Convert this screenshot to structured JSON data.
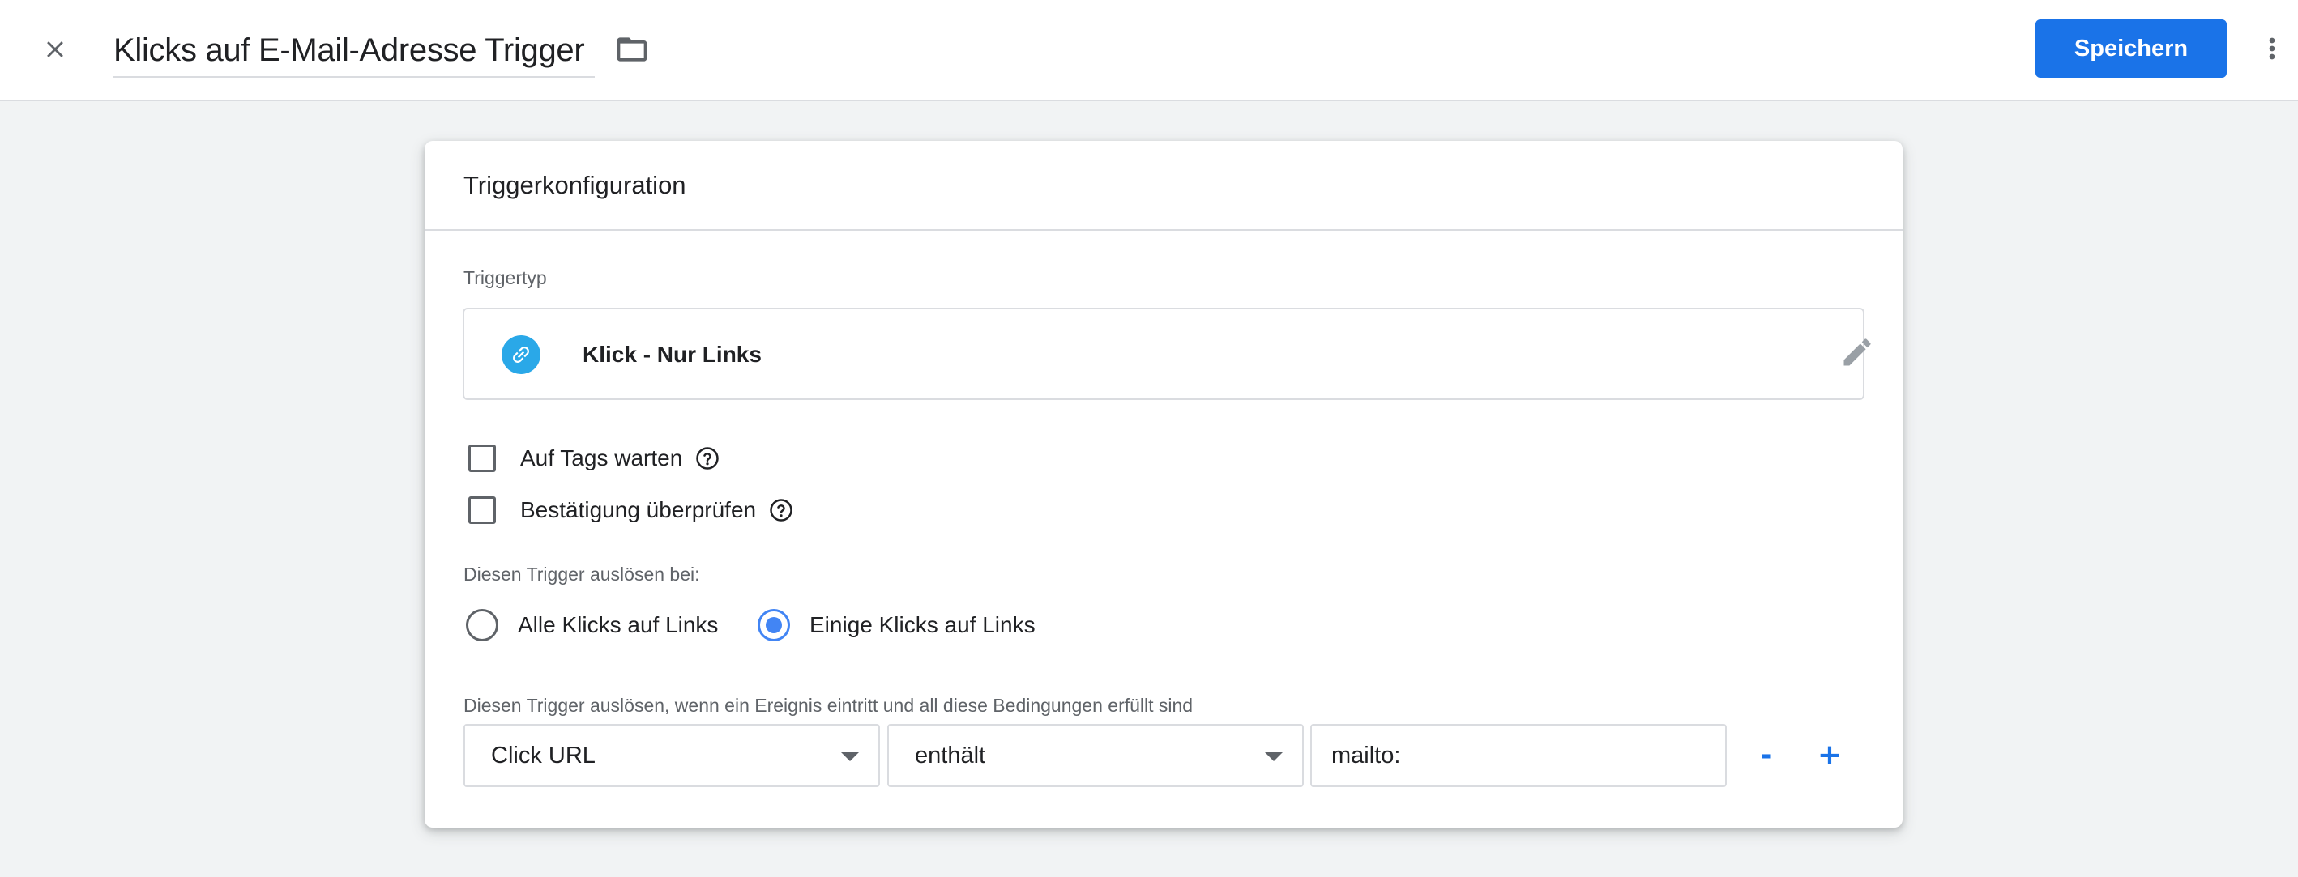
{
  "header": {
    "close_icon": "close-icon",
    "title": "Klicks auf E-Mail-Adresse Trigger",
    "folder_icon": "folder-icon",
    "save_label": "Speichern",
    "more_icon": "more-vert-icon",
    "save_color": "#1a73e8"
  },
  "card": {
    "title": "Triggerkonfiguration",
    "trigger_type_label": "Triggertyp",
    "trigger_type": {
      "icon": "link-icon",
      "icon_color": "#2aa8e8",
      "name": "Klick - Nur Links",
      "edit_icon": "pencil-icon"
    },
    "checkboxes": [
      {
        "label": "Auf Tags warten",
        "checked": false,
        "help_icon": "help-icon"
      },
      {
        "label": "Bestätigung überprüfen",
        "checked": false,
        "help_icon": "help-icon"
      }
    ],
    "fire_on_label": "Diesen Trigger auslösen bei:",
    "radios": [
      {
        "label": "Alle Klicks auf Links",
        "checked": false
      },
      {
        "label": "Einige Klicks auf Links",
        "checked": true
      }
    ],
    "conditions_label": "Diesen Trigger auslösen, wenn ein Ereignis eintritt und all diese Bedingungen erfüllt sind",
    "condition": {
      "variable": "Click URL",
      "operator": "enthält",
      "value": "mailto:",
      "remove_label": "-",
      "add_label": "+"
    }
  }
}
